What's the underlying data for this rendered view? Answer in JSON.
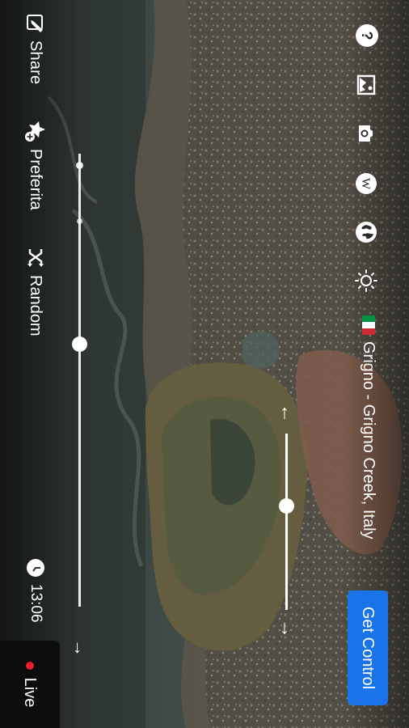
{
  "camera": {
    "title": "Grigno - Grigno Creek, Italy",
    "flag_colors": [
      "#009246",
      "#ffffff",
      "#ce2b37"
    ]
  },
  "controls": {
    "get_control_label": "Get Control",
    "zoom_level": 0.41
  },
  "toolbar": {
    "share_label": "Share",
    "favorite_label": "Preferita",
    "random_label": "Random",
    "time": "13:06",
    "live_label": "Live"
  },
  "timeline": {
    "position": 0.42
  },
  "icons": {
    "left_rail": [
      "help-icon",
      "image-icon",
      "camera-icon",
      "wikipedia-icon",
      "globe-icon",
      "sun-icon"
    ],
    "toolbar": [
      "edit-share-icon",
      "star-plus-icon",
      "shuffle-icon",
      "clock-icon"
    ]
  },
  "colors": {
    "accent": "#1a73e8",
    "live_dot": "#e5202a"
  }
}
